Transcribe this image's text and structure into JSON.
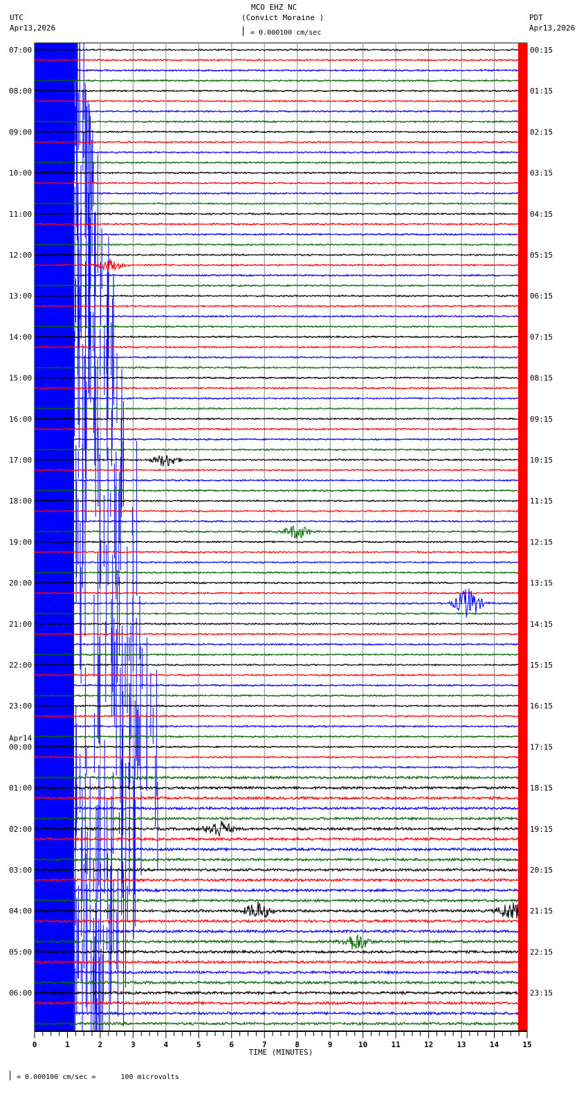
{
  "header": {
    "station": "MCO EHZ NC",
    "site": "(Convict Moraine )",
    "left_tz": "UTC",
    "left_date": "Apr13,2026",
    "right_tz": "PDT",
    "right_date": "Apr13,2026",
    "scale": "= 0.000100 cm/sec"
  },
  "footer": {
    "scale": "= 0.000100 cm/sec =      100 microvolts"
  },
  "chart_data": {
    "type": "line",
    "title": "MCO EHZ NC (Convict Moraine )",
    "xlabel": "TIME (MINUTES)",
    "xlim": [
      0,
      15
    ],
    "x_ticks": [
      "0",
      "1",
      "2",
      "3",
      "4",
      "5",
      "6",
      "7",
      "8",
      "9",
      "10",
      "11",
      "12",
      "13",
      "14",
      "15"
    ],
    "rows_per_hour": 4,
    "row_count": 96,
    "trace_colors": [
      "#000000",
      "#ff0000",
      "#0000ff",
      "#006400"
    ],
    "left_labels": [
      "07:00",
      "08:00",
      "09:00",
      "10:00",
      "11:00",
      "12:00",
      "13:00",
      "14:00",
      "15:00",
      "16:00",
      "17:00",
      "18:00",
      "19:00",
      "20:00",
      "21:00",
      "22:00",
      "23:00",
      "00:00",
      "01:00",
      "02:00",
      "03:00",
      "04:00",
      "05:00",
      "06:00"
    ],
    "left_date_change": "Apr14",
    "right_labels": [
      "00:15",
      "01:15",
      "02:15",
      "03:15",
      "04:15",
      "05:15",
      "06:15",
      "07:15",
      "08:15",
      "09:15",
      "10:15",
      "11:15",
      "12:15",
      "13:15",
      "14:15",
      "15:15",
      "16:15",
      "17:15",
      "18:15",
      "19:15",
      "20:15",
      "21:15",
      "22:15",
      "23:15"
    ],
    "events": [
      {
        "row": 21,
        "minute": 2.3,
        "amp": 8
      },
      {
        "row": 40,
        "minute": 4.0,
        "amp": 9
      },
      {
        "row": 47,
        "minute": 8.0,
        "amp": 10
      },
      {
        "row": 54,
        "minute": 13.2,
        "amp": 22
      },
      {
        "row": 76,
        "minute": 5.6,
        "amp": 12
      },
      {
        "row": 84,
        "minute": 6.8,
        "amp": 12
      },
      {
        "row": 84,
        "minute": 14.5,
        "amp": 12
      },
      {
        "row": 87,
        "minute": 9.8,
        "amp": 12
      }
    ]
  }
}
